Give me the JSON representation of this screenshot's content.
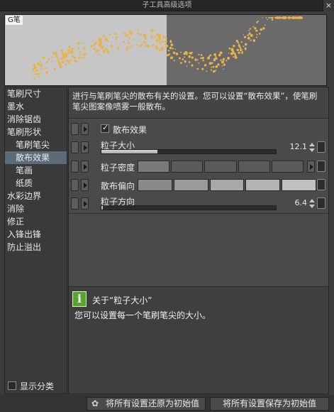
{
  "window": {
    "title": "子工具高级选项",
    "close_label": "×"
  },
  "preview": {
    "label": "G笔"
  },
  "sidebar": {
    "items": [
      {
        "label": "笔刷尺寸",
        "sub": false,
        "selected": false
      },
      {
        "label": "墨水",
        "sub": false,
        "selected": false
      },
      {
        "label": "消除锯齿",
        "sub": false,
        "selected": false
      },
      {
        "label": "笔刷形状",
        "sub": false,
        "selected": false
      },
      {
        "label": "笔刷笔尖",
        "sub": true,
        "selected": false
      },
      {
        "label": "散布效果",
        "sub": true,
        "selected": true
      },
      {
        "label": "笔画",
        "sub": true,
        "selected": false
      },
      {
        "label": "纸质",
        "sub": true,
        "selected": false
      },
      {
        "label": "水彩边界",
        "sub": false,
        "selected": false
      },
      {
        "label": "消除",
        "sub": false,
        "selected": false
      },
      {
        "label": "修正",
        "sub": false,
        "selected": false
      },
      {
        "label": "入锋出锋",
        "sub": false,
        "selected": false
      },
      {
        "label": "防止溢出",
        "sub": false,
        "selected": false
      }
    ],
    "show_category": "显示分类"
  },
  "main": {
    "description": "进行与笔刷笔尖的散布有关的设置。您可以设置“散布效果”，使笔刷笔尖图案像喷雾一般散布。",
    "scatter_effect_label": "散布效果",
    "particle_size_label": "粒子大小",
    "particle_size_value": "12.1",
    "particle_size_fraction": 0.32,
    "particle_density_label": "粒子密度",
    "scatter_bias_label": "散布偏向",
    "particle_direction_label": "粒子方向",
    "particle_direction_value": "6.4"
  },
  "info": {
    "title": "关于“粒子大小”",
    "text": "您可以设置每一个笔刷笔尖的大小。"
  },
  "bottom": {
    "reset_label": "将所有设置还原为初始值",
    "save_label": "将所有设置保存为初始值"
  },
  "colors": {
    "accent_selected": "#5d6a78",
    "info_icon": "#5aa32e",
    "particles": "#e8b34a"
  }
}
